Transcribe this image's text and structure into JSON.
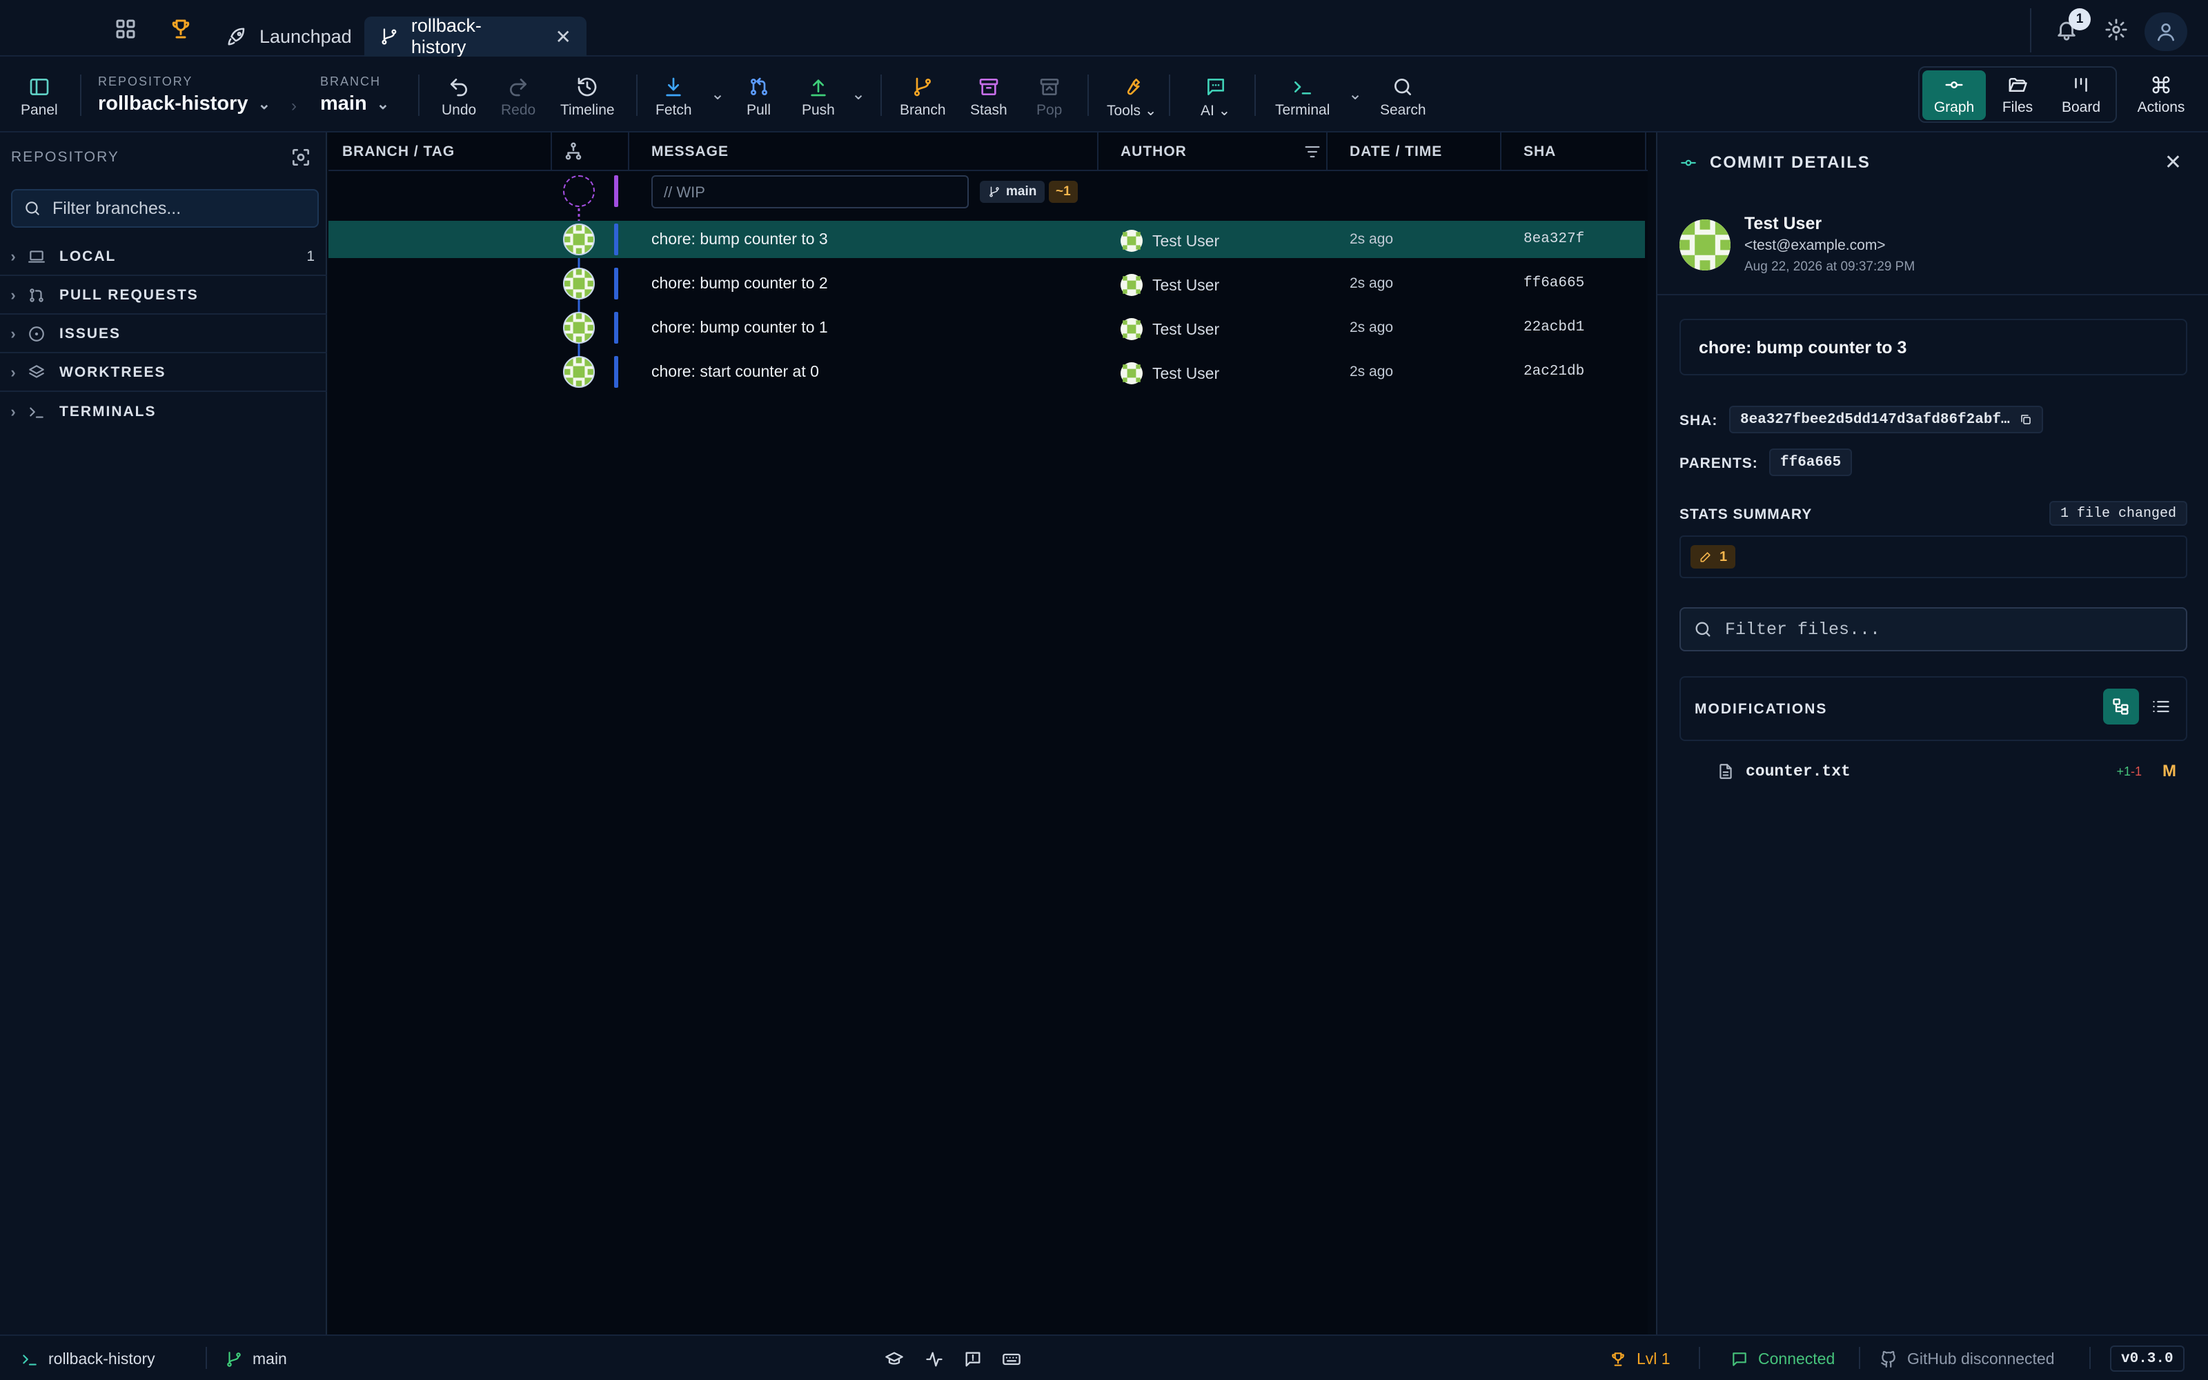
{
  "colors": {
    "accent": "#0f6e63",
    "branch": "#2f62d6",
    "warning": "#f5b64d",
    "success": "#46c37b",
    "wip": "#a24ee0"
  },
  "tabs": {
    "launchpad": "Launchpad",
    "repo": "rollback-history",
    "notification_count": "1"
  },
  "toolbar": {
    "panel": "Panel",
    "repo_label": "REPOSITORY",
    "repo_name": "rollback-history",
    "branch_label": "BRANCH",
    "branch_name": "main",
    "undo": "Undo",
    "redo": "Redo",
    "timeline": "Timeline",
    "fetch": "Fetch",
    "pull": "Pull",
    "push": "Push",
    "branch": "Branch",
    "stash": "Stash",
    "pop": "Pop",
    "tools": "Tools",
    "ai": "AI",
    "terminal": "Terminal",
    "search": "Search",
    "graph": "Graph",
    "files": "Files",
    "board": "Board",
    "actions": "Actions"
  },
  "sidebar": {
    "title": "REPOSITORY",
    "filter_placeholder": "Filter branches...",
    "sections": [
      {
        "label": "LOCAL",
        "count": "1",
        "icon": "laptop-icon"
      },
      {
        "label": "PULL REQUESTS",
        "icon": "pull-request-icon"
      },
      {
        "label": "ISSUES",
        "icon": "issue-icon"
      },
      {
        "label": "WORKTREES",
        "icon": "layers-icon"
      },
      {
        "label": "TERMINALS",
        "icon": "terminal-icon"
      }
    ]
  },
  "graph": {
    "columns": {
      "branch": "BRANCH / TAG",
      "message": "MESSAGE",
      "author": "AUTHOR",
      "date": "DATE / TIME",
      "sha": "SHA"
    },
    "wip_placeholder": "// WIP",
    "wip_ref": "main",
    "wip_changes": "~1",
    "branch_tag": "main",
    "commits": [
      {
        "message": "chore: bump counter to 3",
        "author": "Test User",
        "date": "2s ago",
        "sha": "8ea327f"
      },
      {
        "message": "chore: bump counter to 2",
        "author": "Test User",
        "date": "2s ago",
        "sha": "ff6a665"
      },
      {
        "message": "chore: bump counter to 1",
        "author": "Test User",
        "date": "2s ago",
        "sha": "22acbd1"
      },
      {
        "message": "chore: start counter at 0",
        "author": "Test User",
        "date": "2s ago",
        "sha": "2ac21db"
      }
    ]
  },
  "details": {
    "title": "COMMIT DETAILS",
    "author": "Test User",
    "email": "<test@example.com>",
    "date": "Aug 22, 2026 at 09:37:29 PM",
    "message": "chore: bump counter to 3",
    "sha_label": "SHA:",
    "sha": "8ea327fbee2d5dd147d3afd86f2abf…",
    "parents_label": "PARENTS:",
    "parent": "ff6a665",
    "stats_label": "STATS SUMMARY",
    "files_changed": "1 file changed",
    "modified_count": "1",
    "filter_placeholder": "Filter files...",
    "modifications_label": "MODIFICATIONS",
    "file": {
      "name": "counter.txt",
      "add": "+1",
      "del": "-1",
      "status": "M"
    }
  },
  "statusbar": {
    "repo": "rollback-history",
    "branch": "main",
    "level": "Lvl 1",
    "connection": "Connected",
    "github": "GitHub disconnected",
    "version": "v0.3.0"
  }
}
